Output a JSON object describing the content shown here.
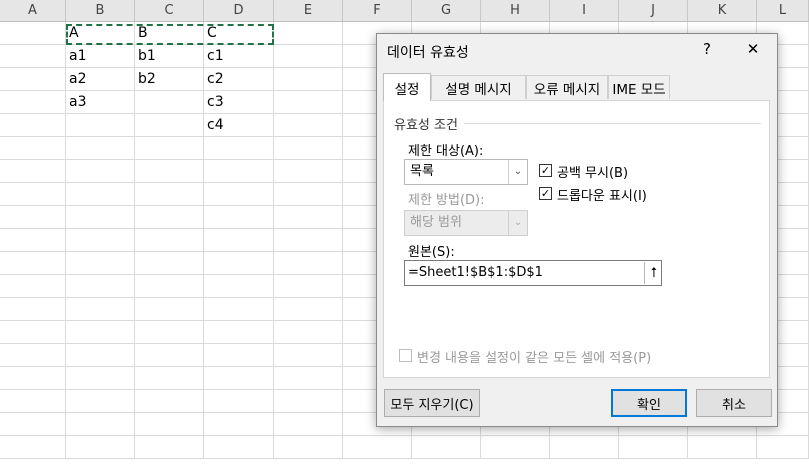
{
  "sheet": {
    "columns": [
      "A",
      "B",
      "C",
      "D",
      "E",
      "F",
      "G",
      "H",
      "I",
      "J",
      "K",
      "L"
    ],
    "cells": {
      "B1": "A",
      "C1": "B",
      "D1": "C",
      "B2": "a1",
      "C2": "b1",
      "D2": "c1",
      "B3": "a2",
      "C3": "b2",
      "D3": "c2",
      "B4": "a3",
      "D4": "c3",
      "D5": "c4"
    }
  },
  "dialog": {
    "title": "데이터 유효성",
    "help_button": "?",
    "close_button": "✕",
    "tabs": [
      "설정",
      "설명 메시지",
      "오류 메시지",
      "IME 모드"
    ],
    "active_tab": 0,
    "group_label": "유효성 조건",
    "allow_label": "제한 대상(A):",
    "allow_value": "목록",
    "data_label": "제한 방법(D):",
    "data_value": "해당 범위",
    "ignore_blank_label": "공백 무시(B)",
    "ignore_blank_checked": true,
    "in_cell_dropdown_label": "드롭다운 표시(I)",
    "in_cell_dropdown_checked": true,
    "source_label": "원본(S):",
    "source_value": "=Sheet1!$B$1:$D$1",
    "apply_all_label": "변경 내용을 설정이 같은 모든 셀에 적용(P)",
    "clear_all_button": "모두 지우기(C)",
    "ok_button": "확인",
    "cancel_button": "취소"
  },
  "colors": {
    "marquee": "#217346",
    "default_button_border": "#0078d7"
  }
}
